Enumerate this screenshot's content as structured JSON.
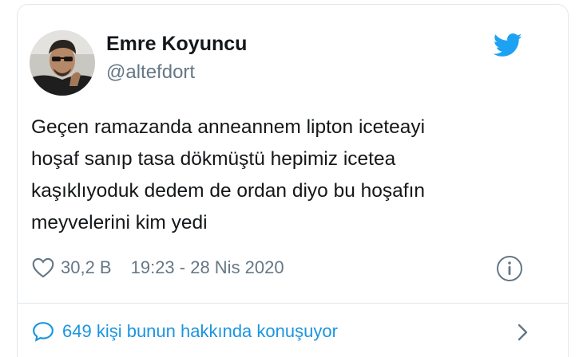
{
  "author": {
    "display_name": "Emre Koyuncu",
    "handle": "@altefdort"
  },
  "tweet": {
    "text_lines": [
      "Geçen ramazanda anneannem lipton iceteayi",
      "hoşaf sanıp tasa dökmüştü hepimiz icetea",
      "kaşıklıyoduk dedem de ordan diyo bu hoşafın",
      "meyvelerini kim yedi"
    ],
    "likes": "30,2 B",
    "timestamp": "19:23 - 28 Nis 2020"
  },
  "conversation": {
    "label": "649 kişi bunun hakkında konuşuyor"
  },
  "colors": {
    "brand_blue": "#1da1f2",
    "link_blue": "#1b95e0",
    "text_primary": "#14171a",
    "text_secondary": "#657786"
  },
  "icons": {
    "brand": "twitter-bird-icon",
    "like": "heart-icon",
    "info": "info-icon",
    "reply": "speech-bubble-icon",
    "next": "chevron-right-icon"
  }
}
